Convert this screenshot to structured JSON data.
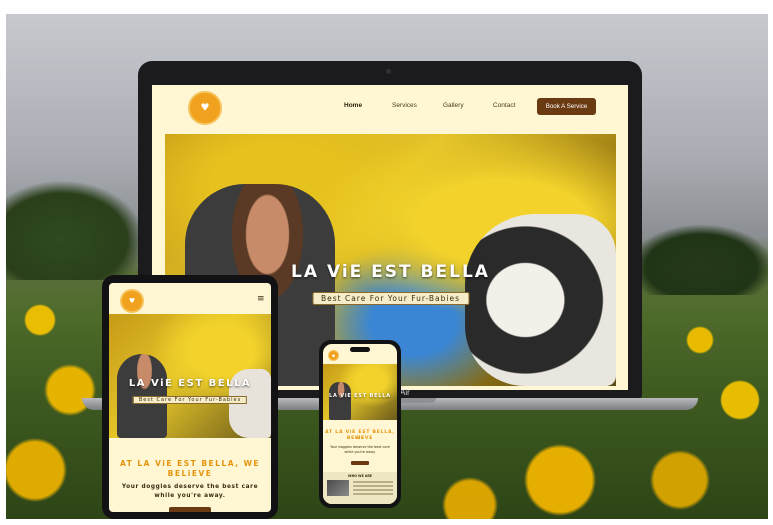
{
  "brand": {
    "accent_color": "#f0a11d",
    "button_color": "#6a3a13",
    "page_bg": "#fff7d4",
    "heading_color": "#e6930d"
  },
  "laptop": {
    "device_label": "Air",
    "nav": {
      "logo_icon": "heart-logo-icon",
      "links": [
        "Home",
        "Services",
        "Gallery",
        "Contact"
      ],
      "active": "Home",
      "cta_label": "Book A Service"
    },
    "hero": {
      "title": "LA ViE EST BELLA",
      "subtitle": "Best Care For Your Fur-Babies"
    }
  },
  "tablet": {
    "menu_icon": "hamburger-menu-icon",
    "hero": {
      "title": "LA ViE EST BELLA",
      "subtitle": "Best Care For Your Fur-Babies"
    },
    "heading_line1": "AT LA ViE EST BELLA, WE",
    "heading_line2": "BELiEVE",
    "text_line1": "Your doggies deserve the best care",
    "text_line2": "while you're away."
  },
  "phone": {
    "hero": {
      "title": "LA ViE EST BELLA"
    },
    "heading_line1": "AT LA ViE EST BELLA, WE",
    "heading_line2": "BELiEVE",
    "text_line1": "Your doggies deserve the best care",
    "text_line2": "while you're away.",
    "section_title": "WHO WE ARE"
  }
}
